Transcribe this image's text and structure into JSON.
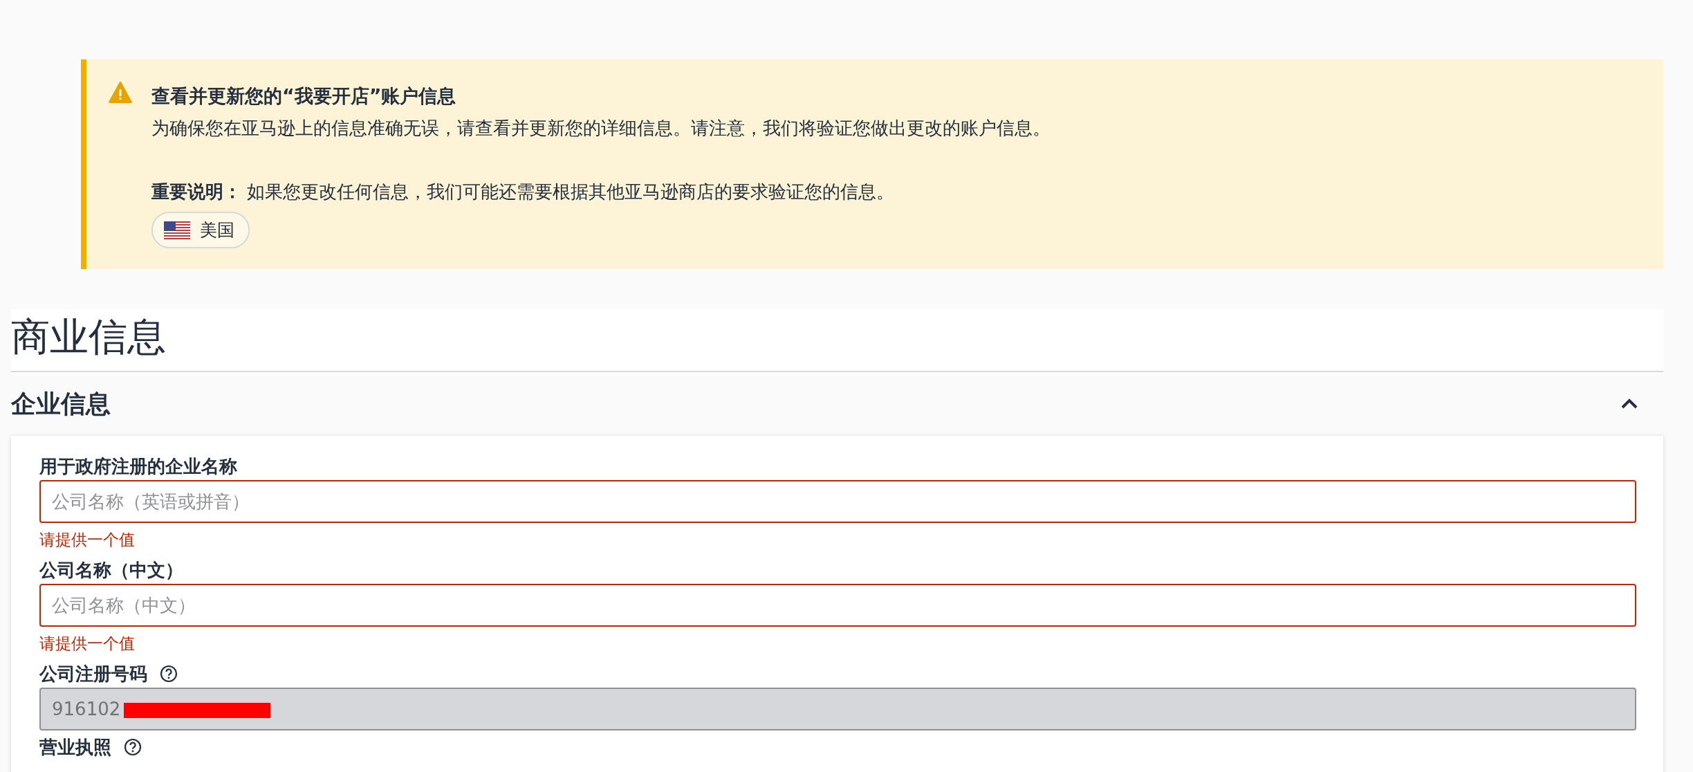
{
  "notice": {
    "title": "查看并更新您的“我要开店”账户信息",
    "body": "为确保您在亚马逊上的信息准确无误，请查看并更新您的详细信息。请注意，我们将验证您做出更改的账户信息。",
    "note": "**重要说明：** 如果您更改任何信息，我们可能还需要根据其他亚马逊商店的要求验证您的信息。",
    "country": "美国"
  },
  "page_title": "商业信息",
  "section": {
    "title": "企业信息",
    "expanded": true,
    "fields": [
      {
        "label": "用于政府注册的企业名称",
        "help": false,
        "placeholder": "公司名称（英语或拼音）",
        "error": "请提供一个值",
        "disabled": false
      },
      {
        "label": "公司名称（中文）",
        "help": false,
        "placeholder": "公司名称（中文）",
        "error": "请提供一个值",
        "disabled": false
      },
      {
        "label": "公司注册号码",
        "help": true,
        "value": "916102",
        "redacted": true,
        "disabled": true
      },
      {
        "label": "营业执照",
        "help": true
      }
    ]
  }
}
